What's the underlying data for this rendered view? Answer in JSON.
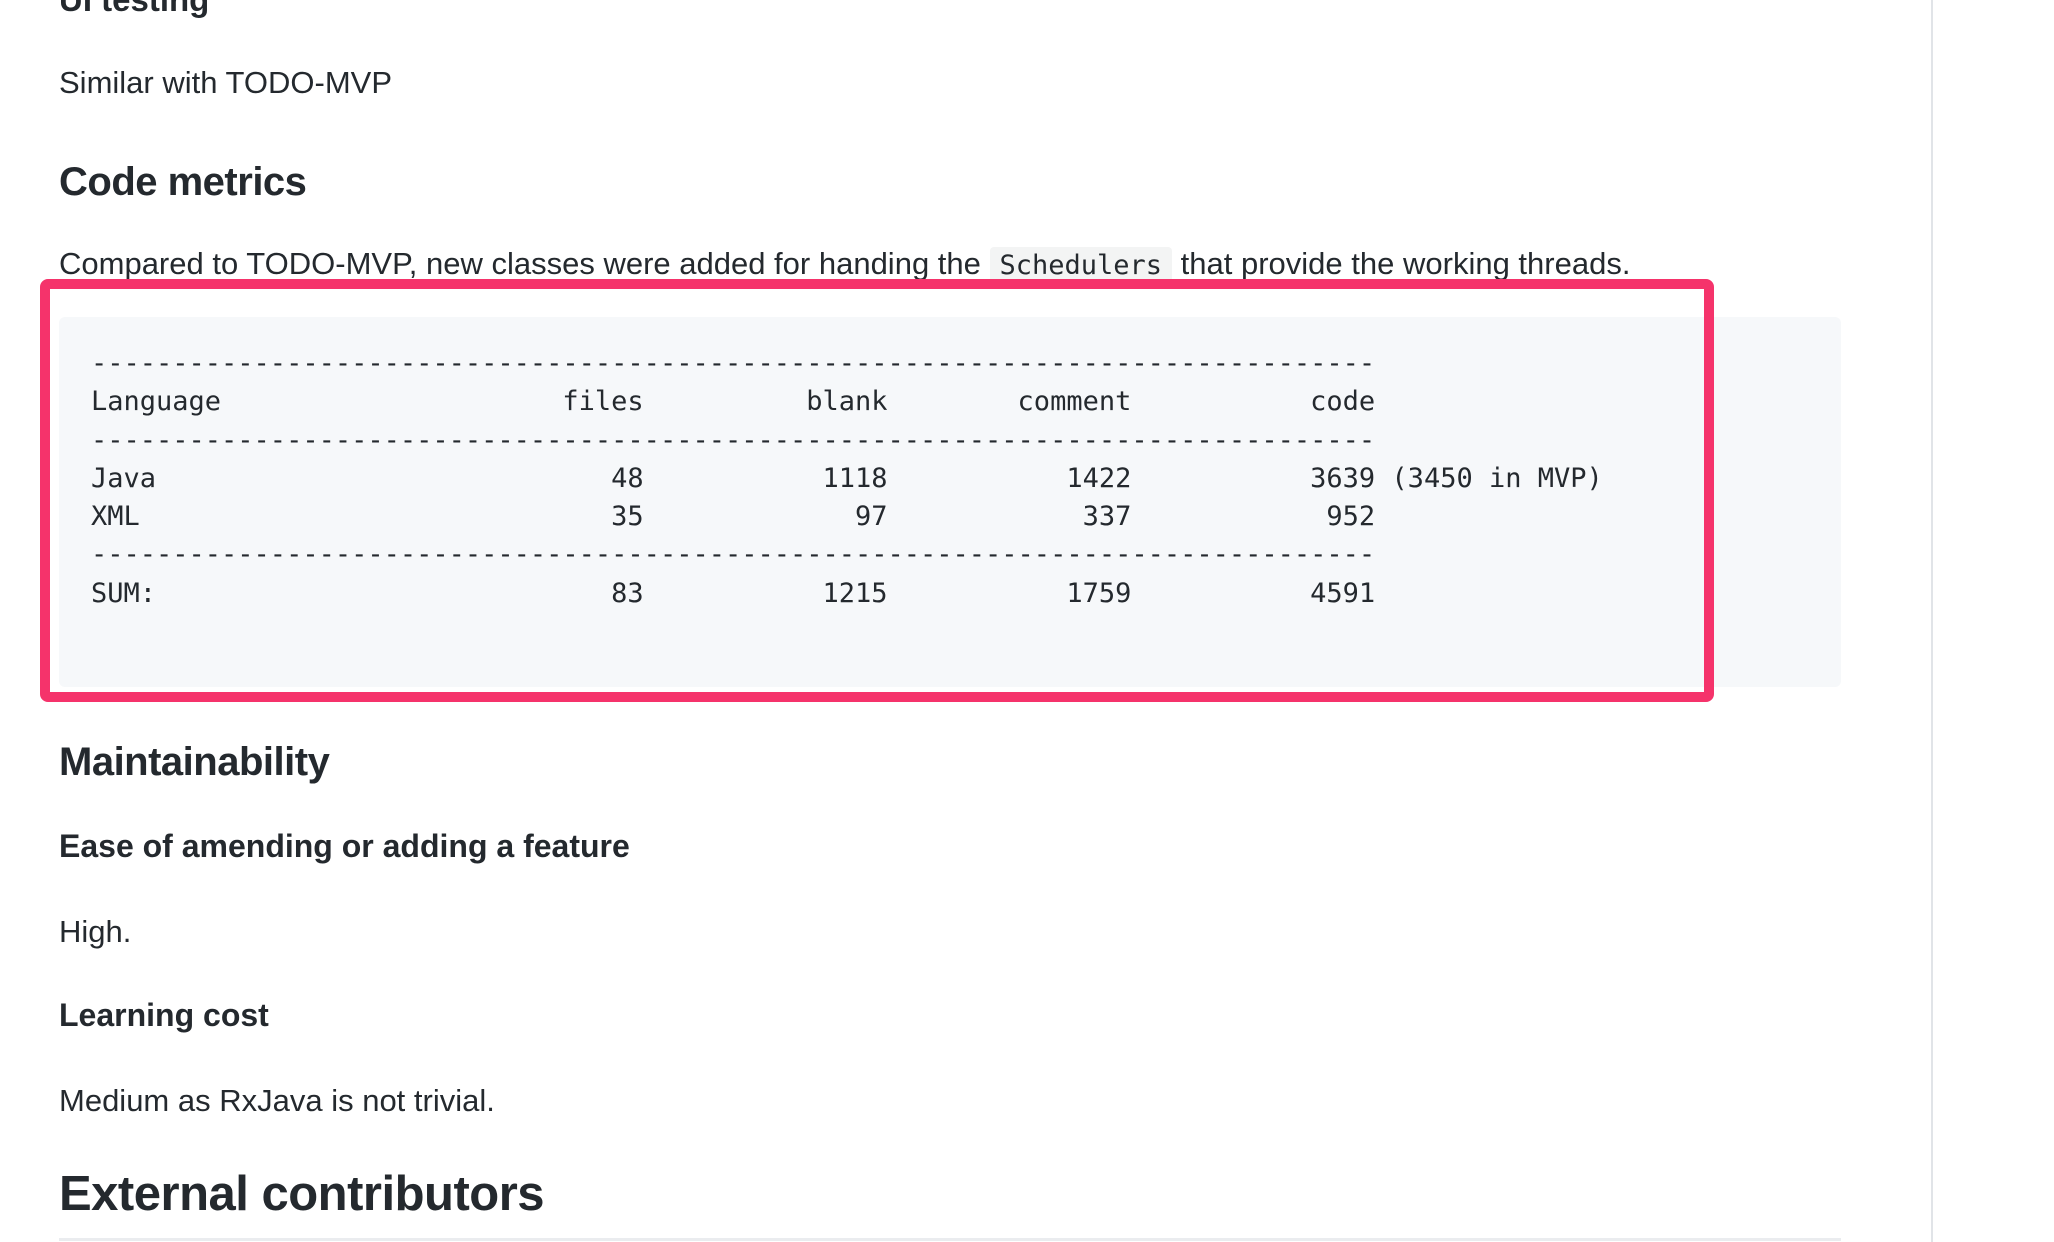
{
  "sections": {
    "ui_testing_heading": "UI testing",
    "ui_testing_text": "Similar with TODO-MVP",
    "code_metrics_heading": "Code metrics",
    "code_metrics_text_before": "Compared to TODO-MVP, new classes were added for handing the ",
    "code_metrics_inline_code": "Schedulers",
    "code_metrics_text_after": " that provide the working threads.",
    "maintainability_heading": "Maintainability",
    "ease_heading": "Ease of amending or adding a feature",
    "ease_text": "High.",
    "learning_heading": "Learning cost",
    "learning_text": "Medium as RxJava is not trivial.",
    "external_heading": "External contributors"
  },
  "code_block": {
    "lines": [
      "-------------------------------------------------------------------------------",
      "Language                     files          blank        comment           code",
      "-------------------------------------------------------------------------------",
      "Java                            48           1118           1422           3639 (3450 in MVP)",
      "XML                             35             97            337            952",
      "-------------------------------------------------------------------------------",
      "SUM:                            83           1215           1759           4591"
    ]
  },
  "colors": {
    "highlight_border": "#f5336b",
    "code_background": "#f6f8fa",
    "text": "#24292e"
  }
}
